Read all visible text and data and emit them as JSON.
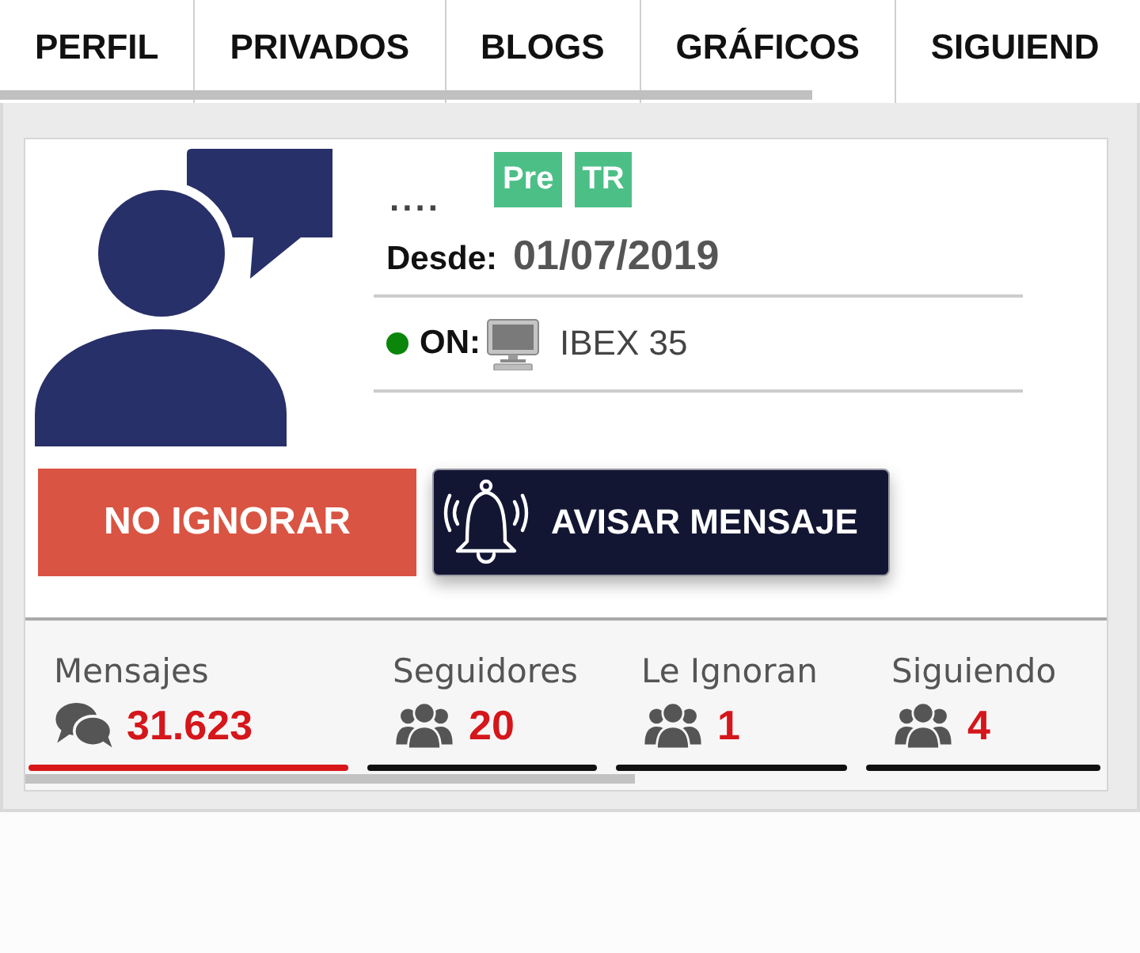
{
  "tabs": [
    {
      "label": "PERFIL"
    },
    {
      "label": "PRIVADOS"
    },
    {
      "label": "BLOGS"
    },
    {
      "label": "GRÁFICOS"
    },
    {
      "label": "SIGUIEND"
    }
  ],
  "profile": {
    "name": "....",
    "badges": [
      "Pre",
      "TR"
    ],
    "since_label": "Desde:",
    "since": "01/07/2019",
    "status": {
      "online": true,
      "label": "ON:",
      "market": "IBEX 35"
    }
  },
  "buttons": [
    {
      "kind": "ignore",
      "label": "NO IGNORAR"
    },
    {
      "kind": "notify",
      "label": "AVISAR MENSAJE"
    }
  ],
  "stats": [
    {
      "kind": "messages",
      "label": "Mensajes",
      "value": "31.623",
      "selected": true
    },
    {
      "kind": "people",
      "label": "Seguidores",
      "value": "20",
      "selected": false
    },
    {
      "kind": "people",
      "label": "Le Ignoran",
      "value": "1",
      "selected": false
    },
    {
      "kind": "people",
      "label": "Siguiendo",
      "value": "4",
      "selected": false
    }
  ]
}
